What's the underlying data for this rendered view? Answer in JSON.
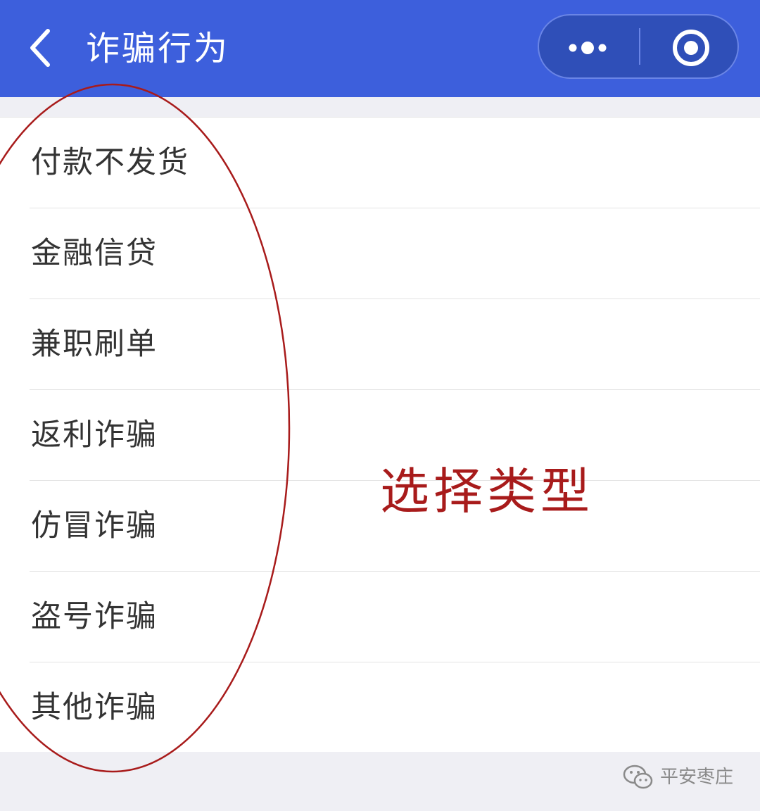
{
  "header": {
    "title": "诈骗行为",
    "back_icon": "chevron-left-icon",
    "more_icon": "more-dots-icon",
    "close_icon": "target-circle-icon",
    "color": "#3d5fdc"
  },
  "list": {
    "items": [
      {
        "label": "付款不发货"
      },
      {
        "label": "金融信贷"
      },
      {
        "label": "兼职刷单"
      },
      {
        "label": "返利诈骗"
      },
      {
        "label": "仿冒诈骗"
      },
      {
        "label": "盗号诈骗"
      },
      {
        "label": "其他诈骗"
      }
    ]
  },
  "annotation": {
    "text": "选择类型",
    "color": "#a81b1b"
  },
  "footer": {
    "brand": "平安枣庄",
    "icon": "wechat-icon"
  }
}
